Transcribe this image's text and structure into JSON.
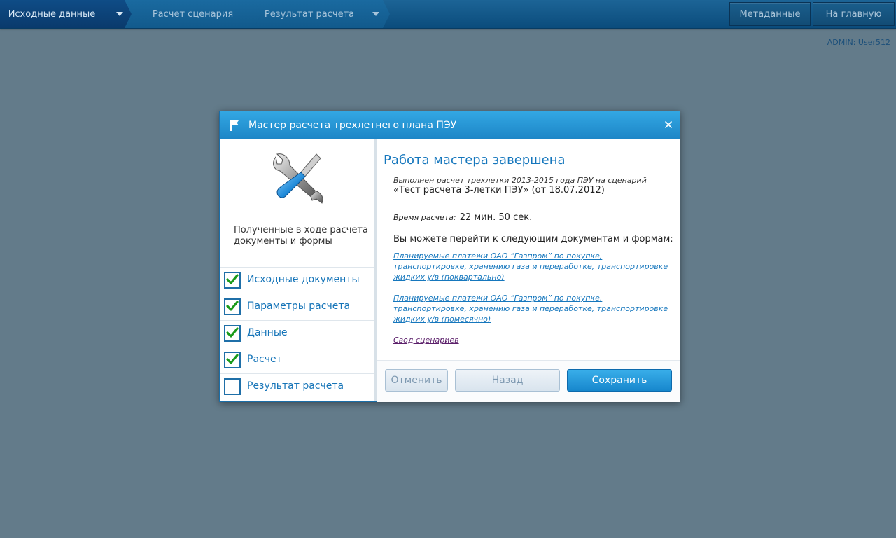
{
  "wizard_steps": [
    {
      "label": "Исходные данные",
      "has_dropdown": true
    },
    {
      "label": "Расчет сценария",
      "has_dropdown": false
    },
    {
      "label": "Результат расчета",
      "has_dropdown": true
    }
  ],
  "top_buttons": {
    "metadata": "Метаданные",
    "home": "На главную"
  },
  "user": {
    "role": "ADMIN:",
    "name": "User512"
  },
  "dialog": {
    "title": "Мастер расчета трехлетнего плана ПЭУ",
    "left": {
      "caption": "Полученные в ходе расчета документы и формы",
      "items": [
        {
          "label": "Исходные документы",
          "checked": true
        },
        {
          "label": "Параметры расчета",
          "checked": true
        },
        {
          "label": "Данные",
          "checked": true
        },
        {
          "label": "Расчет",
          "checked": true
        },
        {
          "label": "Результат расчета",
          "checked": false
        }
      ]
    },
    "right": {
      "heading": "Работа мастера завершена",
      "info_line_1": "Выполнен расчет трехлетки 2013-2015 года ПЭУ на сценарий",
      "info_line_2": "«Тест расчета 3-летки ПЭУ» (от 18.07.2012)",
      "calc_time_label": "Время расчета:",
      "calc_time_value": "22 мин. 50 сек.",
      "next_docs": "Вы можете перейти к следующим документам и формам:",
      "links": [
        "Планируемые платежи ОАО “Газпром” по покупке, транспортировке, хранению газа и переработке, транспортировке жидких у/в  (поквартально)",
        "Планируемые платежи ОАО “Газпром” по покупке, транспортировке, хранению газа и переработке, транспортировке жидких у/в  (помесячно)",
        "Свод сценариев"
      ]
    },
    "buttons": {
      "cancel": "Отменить",
      "back": "Назад",
      "save": "Сохранить"
    }
  },
  "colors": {
    "accent": "#1d86c7",
    "check": "#1a9a1a",
    "background": "#637b8a"
  }
}
